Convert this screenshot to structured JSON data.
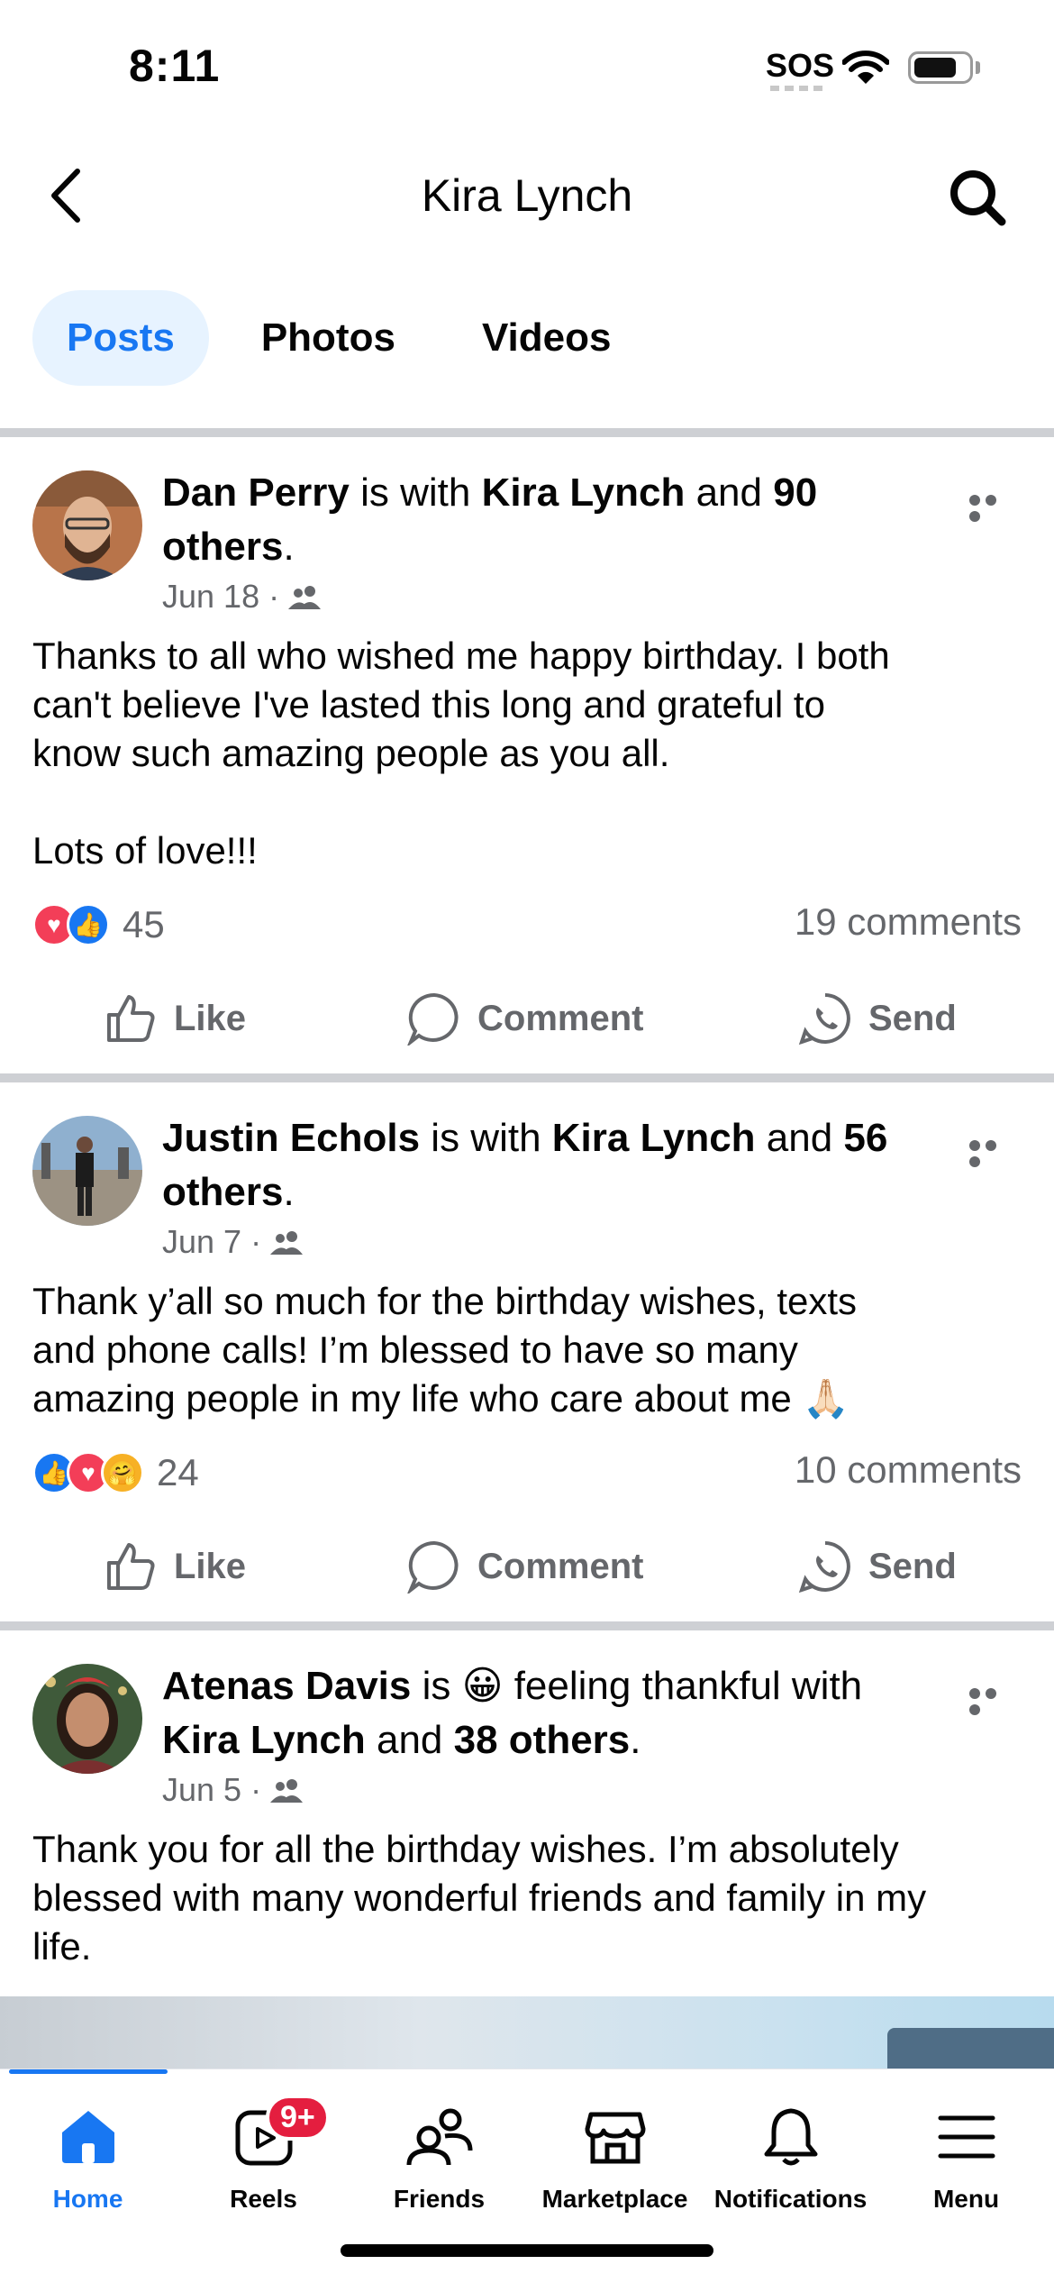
{
  "status": {
    "time": "8:11",
    "sos": "SOS",
    "battery_level": 0.8
  },
  "header": {
    "title": "Kira Lynch",
    "back_icon": "chevron-left-icon",
    "search_icon": "search-icon"
  },
  "tabs": [
    {
      "label": "Posts",
      "active": true
    },
    {
      "label": "Photos",
      "active": false
    },
    {
      "label": "Videos",
      "active": false
    }
  ],
  "posts": [
    {
      "author": "Dan Perry",
      "with_text": " is with ",
      "tagged": "Kira Lynch",
      "and_text": " and ",
      "others": "90 others",
      "end": ".",
      "date": "Jun 18",
      "sep": "·",
      "text_lines": [
        "Thanks to all who wished me happy birthday. I both",
        "can't believe I've lasted this long and grateful to",
        "know such amazing people as you all.",
        "",
        "Lots of love!!!"
      ],
      "reactions": [
        "love",
        "like"
      ],
      "reaction_count": "45",
      "comments": "19 comments"
    },
    {
      "author": "Justin Echols",
      "with_text": " is with ",
      "tagged": "Kira Lynch",
      "and_text": " and ",
      "others": "56 others",
      "end": ".",
      "date": "Jun 7",
      "sep": "·",
      "text_lines": [
        "Thank y’all so much for the birthday wishes, texts",
        "and phone calls! I’m blessed to have so many",
        "amazing people in my life who care about me 🙏🏻"
      ],
      "reactions": [
        "like",
        "love",
        "care"
      ],
      "reaction_count": "24",
      "comments": "10 comments"
    },
    {
      "author": "Atenas Davis",
      "feeling_prefix": " is ",
      "feeling_emoji": "😀",
      "feeling": " feeling thankful with",
      "tagged": "Kira Lynch",
      "and_text": " and ",
      "others": "38 others",
      "end": ".",
      "date": "Jun 5",
      "sep": "·",
      "text_lines": [
        "Thank you for all the birthday wishes. I’m absolutely",
        "blessed with many wonderful friends and family in my",
        "life."
      ]
    }
  ],
  "actions": {
    "like": "Like",
    "comment": "Comment",
    "send": "Send"
  },
  "nav": [
    {
      "label": "Home",
      "icon": "home-icon",
      "active": true
    },
    {
      "label": "Reels",
      "icon": "reels-icon",
      "badge": "9+"
    },
    {
      "label": "Friends",
      "icon": "friends-icon"
    },
    {
      "label": "Marketplace",
      "icon": "marketplace-icon"
    },
    {
      "label": "Notifications",
      "icon": "bell-icon"
    },
    {
      "label": "Menu",
      "icon": "hamburger-icon"
    }
  ]
}
